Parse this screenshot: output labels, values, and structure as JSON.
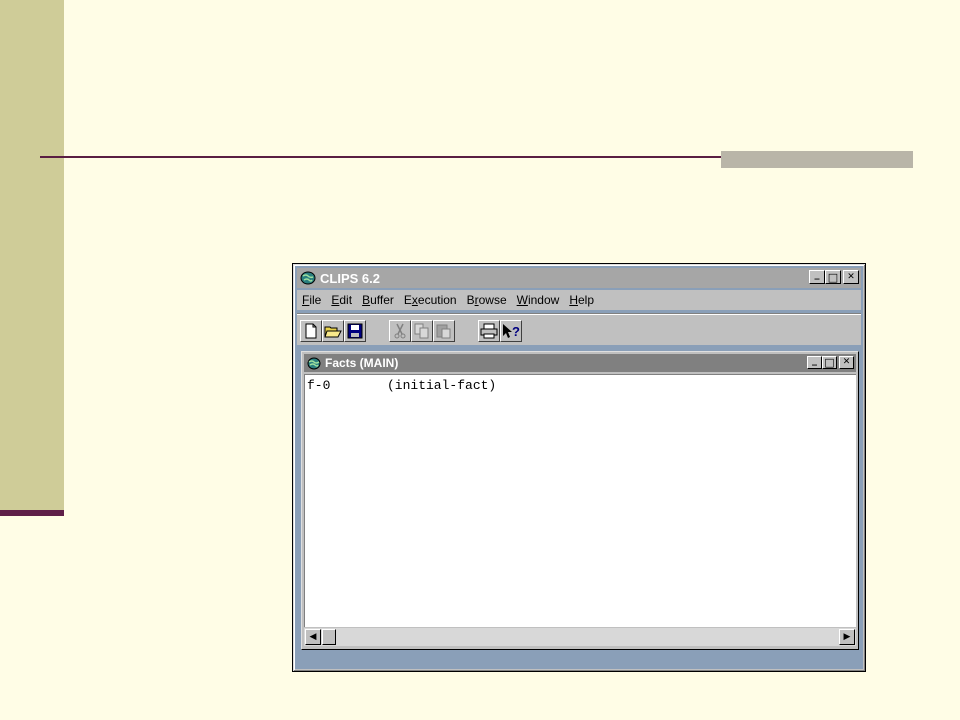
{
  "app": {
    "title": "CLIPS 6.2",
    "icon": "clips-globe-icon",
    "caption_buttons": {
      "minimize": "_",
      "maximize": "□",
      "close": "✕"
    }
  },
  "menu": {
    "items": [
      {
        "label": "File",
        "mnemonic": "F",
        "rest": "ile"
      },
      {
        "label": "Edit",
        "mnemonic": "E",
        "rest": "dit"
      },
      {
        "label": "Buffer",
        "mnemonic": "B",
        "rest": "uffer"
      },
      {
        "label": "Execution",
        "pre": "E",
        "mnemonic": "x",
        "rest": "ecution"
      },
      {
        "label": "Browse",
        "pre": "B",
        "mnemonic": "r",
        "rest": "owse"
      },
      {
        "label": "Window",
        "mnemonic": "W",
        "rest": "indow"
      },
      {
        "label": "Help",
        "mnemonic": "H",
        "rest": "elp"
      }
    ]
  },
  "toolbar": {
    "buttons": [
      "new-file-icon",
      "open-folder-icon",
      "save-disk-icon",
      "cut-scissors-icon",
      "copy-icon",
      "paste-icon",
      "print-icon",
      "context-help-icon"
    ]
  },
  "facts_window": {
    "title": "Facts (MAIN)",
    "rows": [
      {
        "id": "f-0",
        "fact": "(initial-fact)"
      }
    ]
  },
  "colors": {
    "slide_background": "#fffde6",
    "left_bar": "#cfcc98",
    "accent_rule": "#5a1e42",
    "window_face": "#c0c0c0",
    "mdi_background": "#8a9fb8"
  }
}
